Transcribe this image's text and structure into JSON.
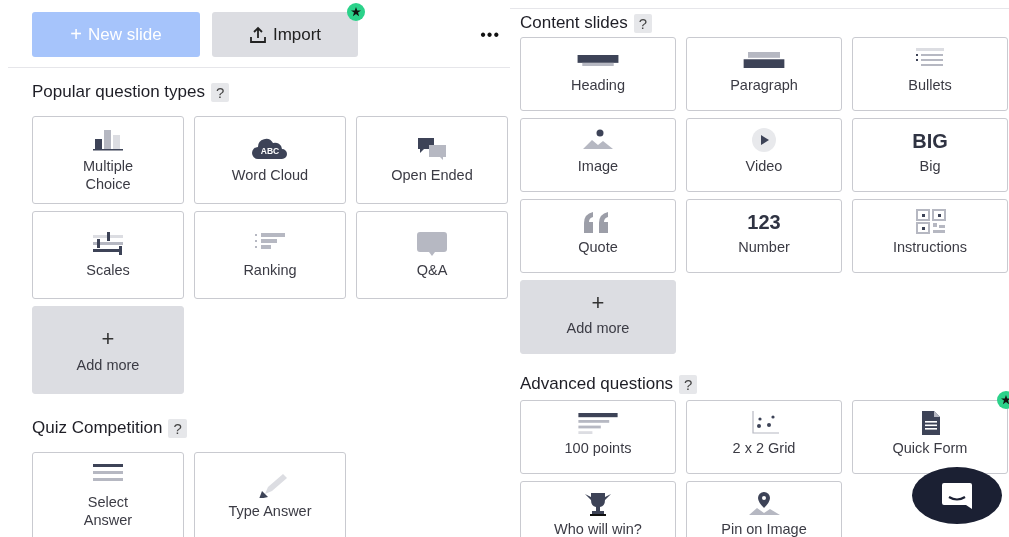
{
  "toolbar": {
    "new_slide": {
      "icon": "+",
      "label": "New slide",
      "disabled": true
    },
    "import": {
      "label": "Import",
      "starred": true
    },
    "more_menu": "•••"
  },
  "left_sections": [
    {
      "title": "Popular question types",
      "help": "?",
      "tiles": [
        {
          "kind": "bars",
          "label": "Multiple Choice"
        },
        {
          "kind": "cloud",
          "glyph": "ABC",
          "label": "Word Cloud"
        },
        {
          "kind": "bubbles",
          "label": "Open Ended"
        },
        {
          "kind": "sliders",
          "label": "Scales"
        },
        {
          "kind": "ranking",
          "label": "Ranking"
        },
        {
          "kind": "bubble",
          "label": "Q&A"
        },
        {
          "kind": "add",
          "glyph": "+",
          "label": "Add more"
        }
      ]
    },
    {
      "title": "Quiz Competition",
      "help": "?",
      "tiles": [
        {
          "kind": "lines",
          "label": "Select Answer"
        },
        {
          "kind": "pencil",
          "label": "Type Answer"
        }
      ]
    }
  ],
  "right_sections": [
    {
      "title": "Content slides",
      "help": "?",
      "tiles": [
        {
          "kind": "heading",
          "label": "Heading"
        },
        {
          "kind": "paragraph",
          "label": "Paragraph"
        },
        {
          "kind": "bullets",
          "label": "Bullets"
        },
        {
          "kind": "image",
          "label": "Image"
        },
        {
          "kind": "video",
          "label": "Video"
        },
        {
          "kind": "text",
          "glyph": "BIG",
          "label": "Big"
        },
        {
          "kind": "quote",
          "label": "Quote"
        },
        {
          "kind": "text",
          "glyph": "123",
          "label": "Number"
        },
        {
          "kind": "qr",
          "label": "Instructions"
        },
        {
          "kind": "add",
          "glyph": "+",
          "label": "Add more"
        }
      ]
    },
    {
      "title": "Advanced questions",
      "help": "?",
      "tiles": [
        {
          "kind": "points",
          "label": "100 points"
        },
        {
          "kind": "grid",
          "label": "2 x 2 Grid"
        },
        {
          "kind": "form",
          "label": "Quick Form",
          "starred": true
        },
        {
          "kind": "trophy",
          "label": "Who will win?"
        },
        {
          "kind": "pin",
          "label": "Pin on Image"
        }
      ]
    }
  ]
}
